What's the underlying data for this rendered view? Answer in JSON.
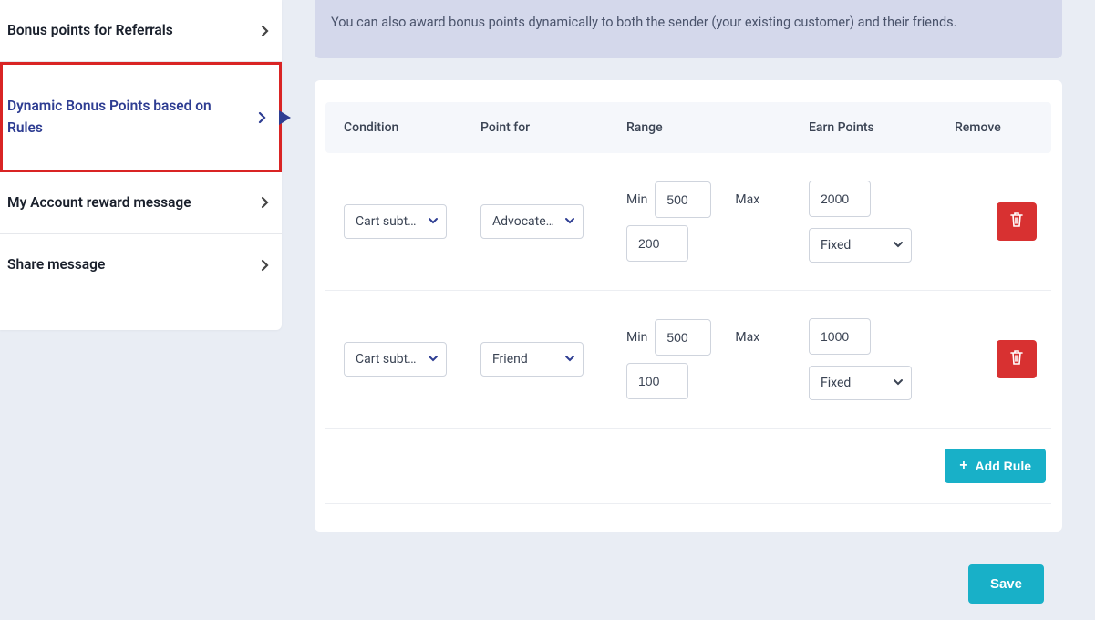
{
  "sidebar": {
    "items": [
      {
        "label": "Bonus points for Referrals"
      },
      {
        "label": "Dynamic Bonus Points based on Rules"
      },
      {
        "label": "My Account reward message"
      },
      {
        "label": "Share message"
      }
    ]
  },
  "banner": {
    "text": "You can also award bonus points dynamically to both the sender (your existing customer) and their friends."
  },
  "table": {
    "headers": {
      "condition": "Condition",
      "point_for": "Point for",
      "range": "Range",
      "earn_points": "Earn Points",
      "remove": "Remove"
    },
    "range_labels": {
      "min": "Min",
      "max": "Max"
    },
    "rows": [
      {
        "condition": "Cart subtotal",
        "point_for": "Advocate/...",
        "min": "500",
        "max_or_second": "200",
        "earn_value": "2000",
        "earn_type": "Fixed"
      },
      {
        "condition": "Cart subtotal",
        "point_for": "Friend",
        "min": "500",
        "max_or_second": "100",
        "earn_value": "1000",
        "earn_type": "Fixed"
      }
    ]
  },
  "buttons": {
    "add_rule": "Add Rule",
    "save": "Save"
  }
}
